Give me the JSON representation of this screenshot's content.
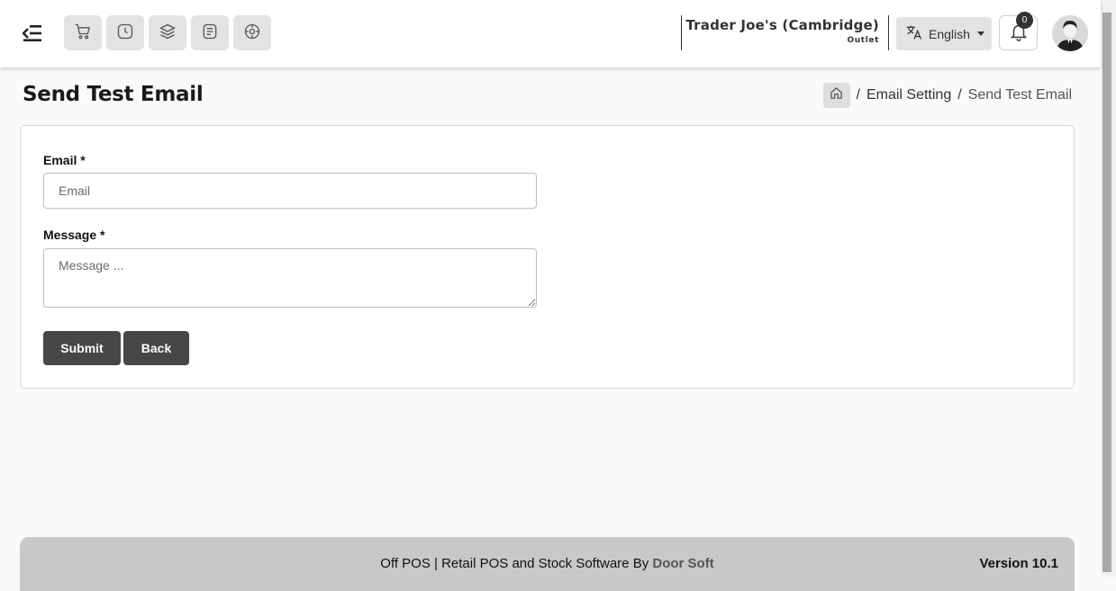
{
  "header": {
    "quick_actions": [
      {
        "icon": "cart-icon"
      },
      {
        "icon": "clock-icon"
      },
      {
        "icon": "layers-icon"
      },
      {
        "icon": "receipt-icon"
      },
      {
        "icon": "settings-wheel-icon"
      }
    ],
    "outlet_name": "Trader Joe's (Cambridge)",
    "outlet_type": "Outlet",
    "language": "English",
    "notification_count": "0"
  },
  "page": {
    "title": "Send Test Email",
    "breadcrumb": {
      "link": "Email Setting",
      "current": "Send Test Email"
    }
  },
  "form": {
    "email_label": "Email *",
    "email_placeholder": "Email",
    "email_value": "",
    "message_label": "Message *",
    "message_placeholder": "Message ...",
    "message_value": "",
    "submit_label": "Submit",
    "back_label": "Back"
  },
  "footer": {
    "text_prefix": "Off POS | Retail POS and Stock Software By",
    "brand": "Door Soft",
    "version": "Version 10.1"
  },
  "colors": {
    "button": "#474747",
    "header_bg": "#ffffff",
    "footer_bg": "#c8c8c8",
    "quick_btn_bg": "#e3e3e3"
  }
}
